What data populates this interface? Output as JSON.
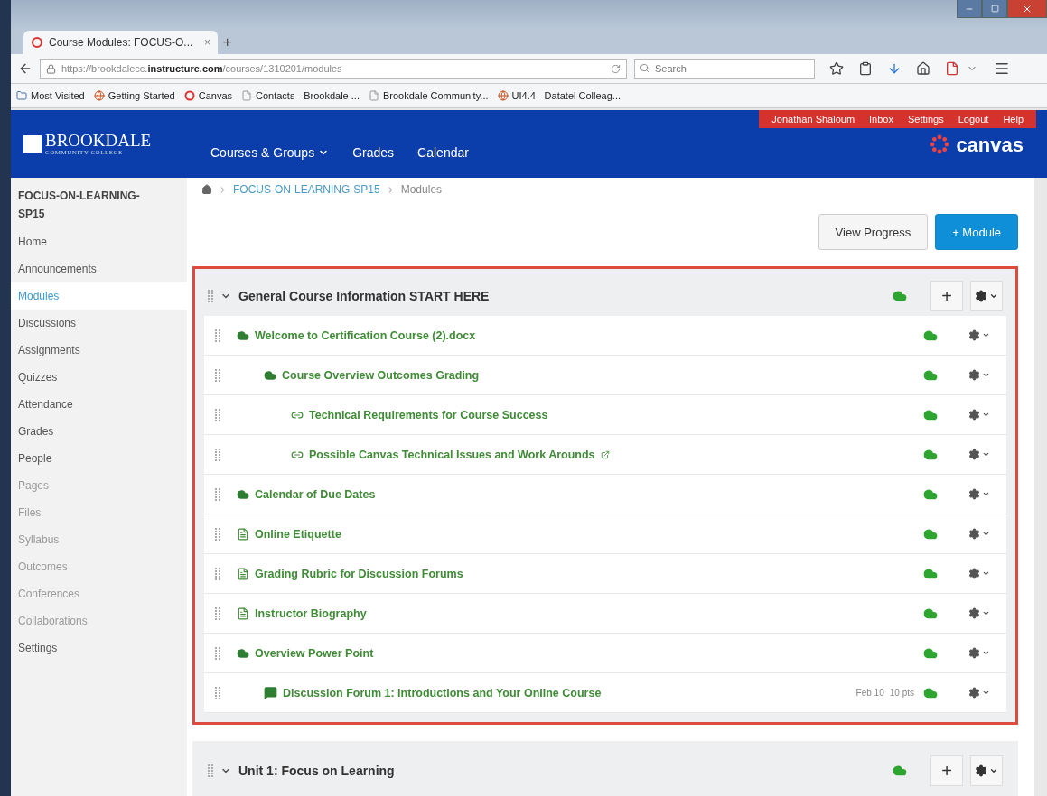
{
  "browser": {
    "tab_title": "Course Modules: FOCUS-O...",
    "tab_close": "×",
    "new_tab": "+",
    "url_prefix": "https://brookdalecc.",
    "url_domain": "instructure.com",
    "url_path": "/courses/1310201/modules",
    "search_placeholder": "Search",
    "bookmarks": [
      {
        "label": "Most Visited",
        "kind": "folder"
      },
      {
        "label": "Getting Started",
        "kind": "globe"
      },
      {
        "label": "Canvas",
        "kind": "ring"
      },
      {
        "label": "Contacts - Brookdale ...",
        "kind": "page"
      },
      {
        "label": "Brookdale Community...",
        "kind": "page"
      },
      {
        "label": "UI4.4 - Datatel Colleag...",
        "kind": "globe"
      }
    ]
  },
  "user_bar": [
    {
      "label": "Jonathan Shaloum"
    },
    {
      "label": "Inbox"
    },
    {
      "label": "Settings"
    },
    {
      "label": "Logout"
    },
    {
      "label": "Help"
    }
  ],
  "logo": {
    "name": "BROOKDALE",
    "subtitle": "COMMUNITY COLLEGE"
  },
  "nav": [
    {
      "label": "Courses & Groups",
      "dropdown": true
    },
    {
      "label": "Grades",
      "dropdown": false
    },
    {
      "label": "Calendar",
      "dropdown": false
    }
  ],
  "brand": "canvas",
  "sidebar": {
    "course_title": "FOCUS-ON-LEARNING-SP15",
    "items": [
      {
        "label": "Home",
        "selected": false,
        "disabled": false
      },
      {
        "label": "Announcements",
        "selected": false,
        "disabled": false
      },
      {
        "label": "Modules",
        "selected": true,
        "disabled": false
      },
      {
        "label": "Discussions",
        "selected": false,
        "disabled": false
      },
      {
        "label": "Assignments",
        "selected": false,
        "disabled": false
      },
      {
        "label": "Quizzes",
        "selected": false,
        "disabled": false
      },
      {
        "label": "Attendance",
        "selected": false,
        "disabled": false
      },
      {
        "label": "Grades",
        "selected": false,
        "disabled": false
      },
      {
        "label": "People",
        "selected": false,
        "disabled": false
      },
      {
        "label": "Pages",
        "selected": false,
        "disabled": true
      },
      {
        "label": "Files",
        "selected": false,
        "disabled": true
      },
      {
        "label": "Syllabus",
        "selected": false,
        "disabled": true
      },
      {
        "label": "Outcomes",
        "selected": false,
        "disabled": true
      },
      {
        "label": "Conferences",
        "selected": false,
        "disabled": true
      },
      {
        "label": "Collaborations",
        "selected": false,
        "disabled": true
      },
      {
        "label": "Settings",
        "selected": false,
        "disabled": false
      }
    ]
  },
  "breadcrumb": [
    {
      "label": "FOCUS-ON-LEARNING-SP15",
      "link": true
    },
    {
      "label": "Modules",
      "link": false
    }
  ],
  "actions": {
    "view_progress": "View Progress",
    "add_module": "+ Module"
  },
  "modules": [
    {
      "title": "General Course Information START HERE",
      "expanded": true,
      "highlighted": true,
      "published": true,
      "add": "+",
      "items": [
        {
          "kind": "attachment",
          "title": "Welcome to Certification Course (2).docx",
          "published": true,
          "children": [
            {
              "kind": "attachment",
              "title": "Course Overview Outcomes Grading",
              "published": true,
              "children": [
                {
                  "kind": "link",
                  "title": "Technical Requirements for Course Success",
                  "published": true,
                  "external": false
                },
                {
                  "kind": "link",
                  "title": "Possible Canvas Technical Issues and Work Arounds",
                  "published": true,
                  "external": true
                }
              ]
            }
          ]
        },
        {
          "kind": "attachment",
          "title": "Calendar of Due Dates",
          "published": true
        },
        {
          "kind": "page",
          "title": "Online Etiquette",
          "published": true
        },
        {
          "kind": "page",
          "title": "Grading Rubric for Discussion Forums",
          "published": true
        },
        {
          "kind": "page",
          "title": "Instructor Biography",
          "published": true
        },
        {
          "kind": "attachment",
          "title": "Overview Power Point",
          "published": true,
          "children": [
            {
              "kind": "discussion",
              "title": "Discussion Forum 1: Introductions and Your Online Course",
              "published": true,
              "due": "Feb 10",
              "points": "10 pts"
            }
          ]
        }
      ]
    },
    {
      "title": "Unit 1: Focus on Learning",
      "expanded": true,
      "highlighted": false,
      "published": true,
      "add": "+"
    }
  ]
}
